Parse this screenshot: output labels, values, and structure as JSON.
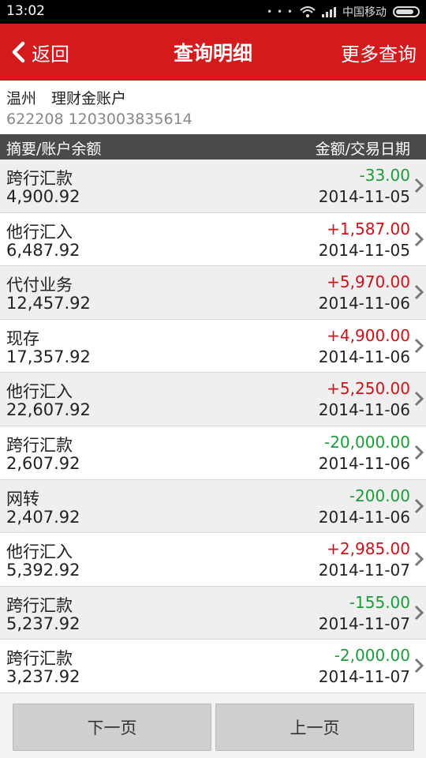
{
  "status_bar": {
    "time": "13:02",
    "dots": "• • •",
    "carrier": "中国移动",
    "icons": [
      "wifi-icon",
      "signal-icon",
      "battery-icon"
    ]
  },
  "header": {
    "back_label": "返回",
    "title": "查询明细",
    "more_label": "更多查询"
  },
  "account": {
    "name": "温州　理财金账户",
    "number": "622208 1203003835614"
  },
  "columns": {
    "left": "摘要/账户余额",
    "right": "金额/交易日期"
  },
  "transactions": [
    {
      "summary": "跨行汇款",
      "balance": "4,900.92",
      "amount": "-33.00",
      "date": "2014-11-05",
      "direction": "neg"
    },
    {
      "summary": "他行汇入",
      "balance": "6,487.92",
      "amount": "+1,587.00",
      "date": "2014-11-05",
      "direction": "pos"
    },
    {
      "summary": "代付业务",
      "balance": "12,457.92",
      "amount": "+5,970.00",
      "date": "2014-11-06",
      "direction": "pos"
    },
    {
      "summary": "现存",
      "balance": "17,357.92",
      "amount": "+4,900.00",
      "date": "2014-11-06",
      "direction": "pos"
    },
    {
      "summary": "他行汇入",
      "balance": "22,607.92",
      "amount": "+5,250.00",
      "date": "2014-11-06",
      "direction": "pos"
    },
    {
      "summary": "跨行汇款",
      "balance": "2,607.92",
      "amount": "-20,000.00",
      "date": "2014-11-06",
      "direction": "neg"
    },
    {
      "summary": "网转",
      "balance": "2,407.92",
      "amount": "-200.00",
      "date": "2014-11-06",
      "direction": "neg"
    },
    {
      "summary": "他行汇入",
      "balance": "5,392.92",
      "amount": "+2,985.00",
      "date": "2014-11-07",
      "direction": "pos"
    },
    {
      "summary": "跨行汇款",
      "balance": "5,237.92",
      "amount": "-155.00",
      "date": "2014-11-07",
      "direction": "neg"
    },
    {
      "summary": "跨行汇款",
      "balance": "3,237.92",
      "amount": "-2,000.00",
      "date": "2014-11-07",
      "direction": "neg"
    }
  ],
  "footer": {
    "next_label": "下一页",
    "prev_label": "上一页"
  },
  "colors": {
    "brand_red": "#d31b1e",
    "positive": "#c8141a",
    "negative": "#1f9a3a",
    "column_header": "#4a4a4a"
  }
}
